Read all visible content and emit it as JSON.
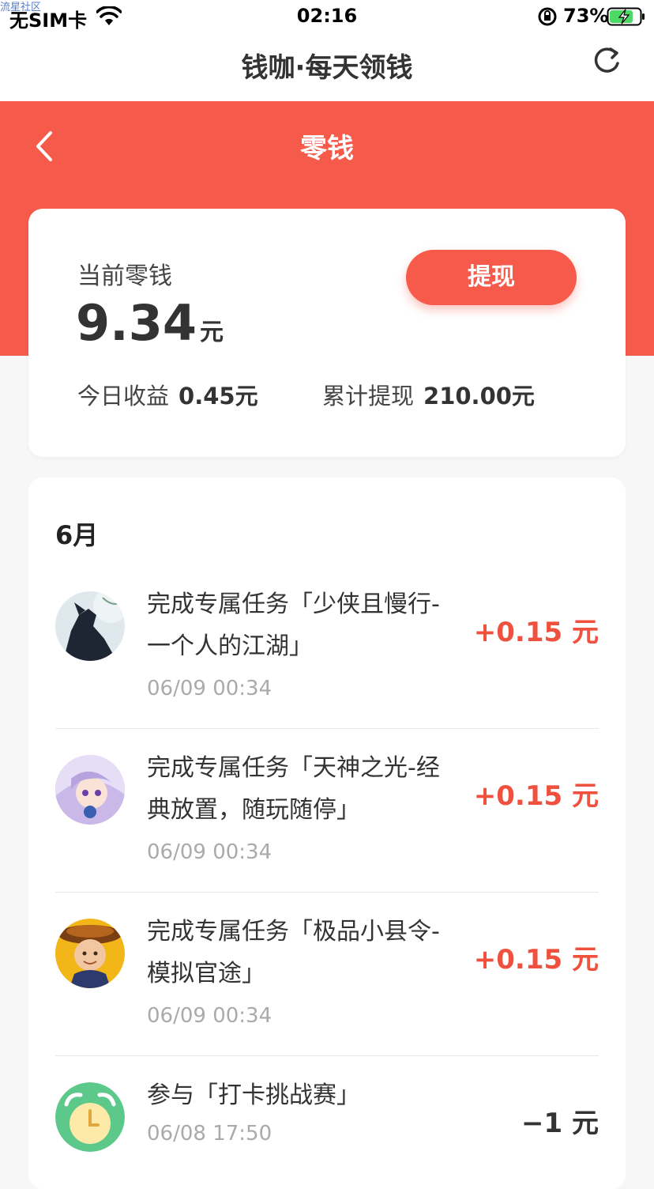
{
  "status_bar": {
    "watermark": "流星社区",
    "carrier": "无SIM卡",
    "time": "02:16",
    "battery_pct": "73%"
  },
  "app_bar": {
    "title": "钱咖·每天领钱",
    "refresh_icon": "refresh-icon"
  },
  "header": {
    "title": "零钱",
    "back_icon": "chevron-left-icon",
    "bg_color": "#f65a4a"
  },
  "balance": {
    "label": "当前零钱",
    "amount": "9.34",
    "unit": "元",
    "withdraw_label": "提现",
    "today_label": "今日收益",
    "today_value": "0.45元",
    "total_label": "累计提现",
    "total_value": "210.00元"
  },
  "history": {
    "month": "6月",
    "items": [
      {
        "avatar": "game-avatar-shaoxia",
        "desc": "完成专属任务「少侠且慢行-一个人的江湖」",
        "time": "06/09 00:34",
        "amount": "+0.15 元"
      },
      {
        "avatar": "game-avatar-tianshen",
        "desc": "完成专属任务「天神之光-经典放置，随玩随停」",
        "time": "06/09 00:34",
        "amount": "+0.15 元"
      },
      {
        "avatar": "game-avatar-xianling",
        "desc": "完成专属任务「极品小县令-模拟官途」",
        "time": "06/09 00:34",
        "amount": "+0.15 元"
      },
      {
        "avatar": "alarm-clock-icon",
        "desc": "参与「打卡挑战赛」",
        "time": "06/08 17:50",
        "amount": "−1 元"
      }
    ]
  }
}
